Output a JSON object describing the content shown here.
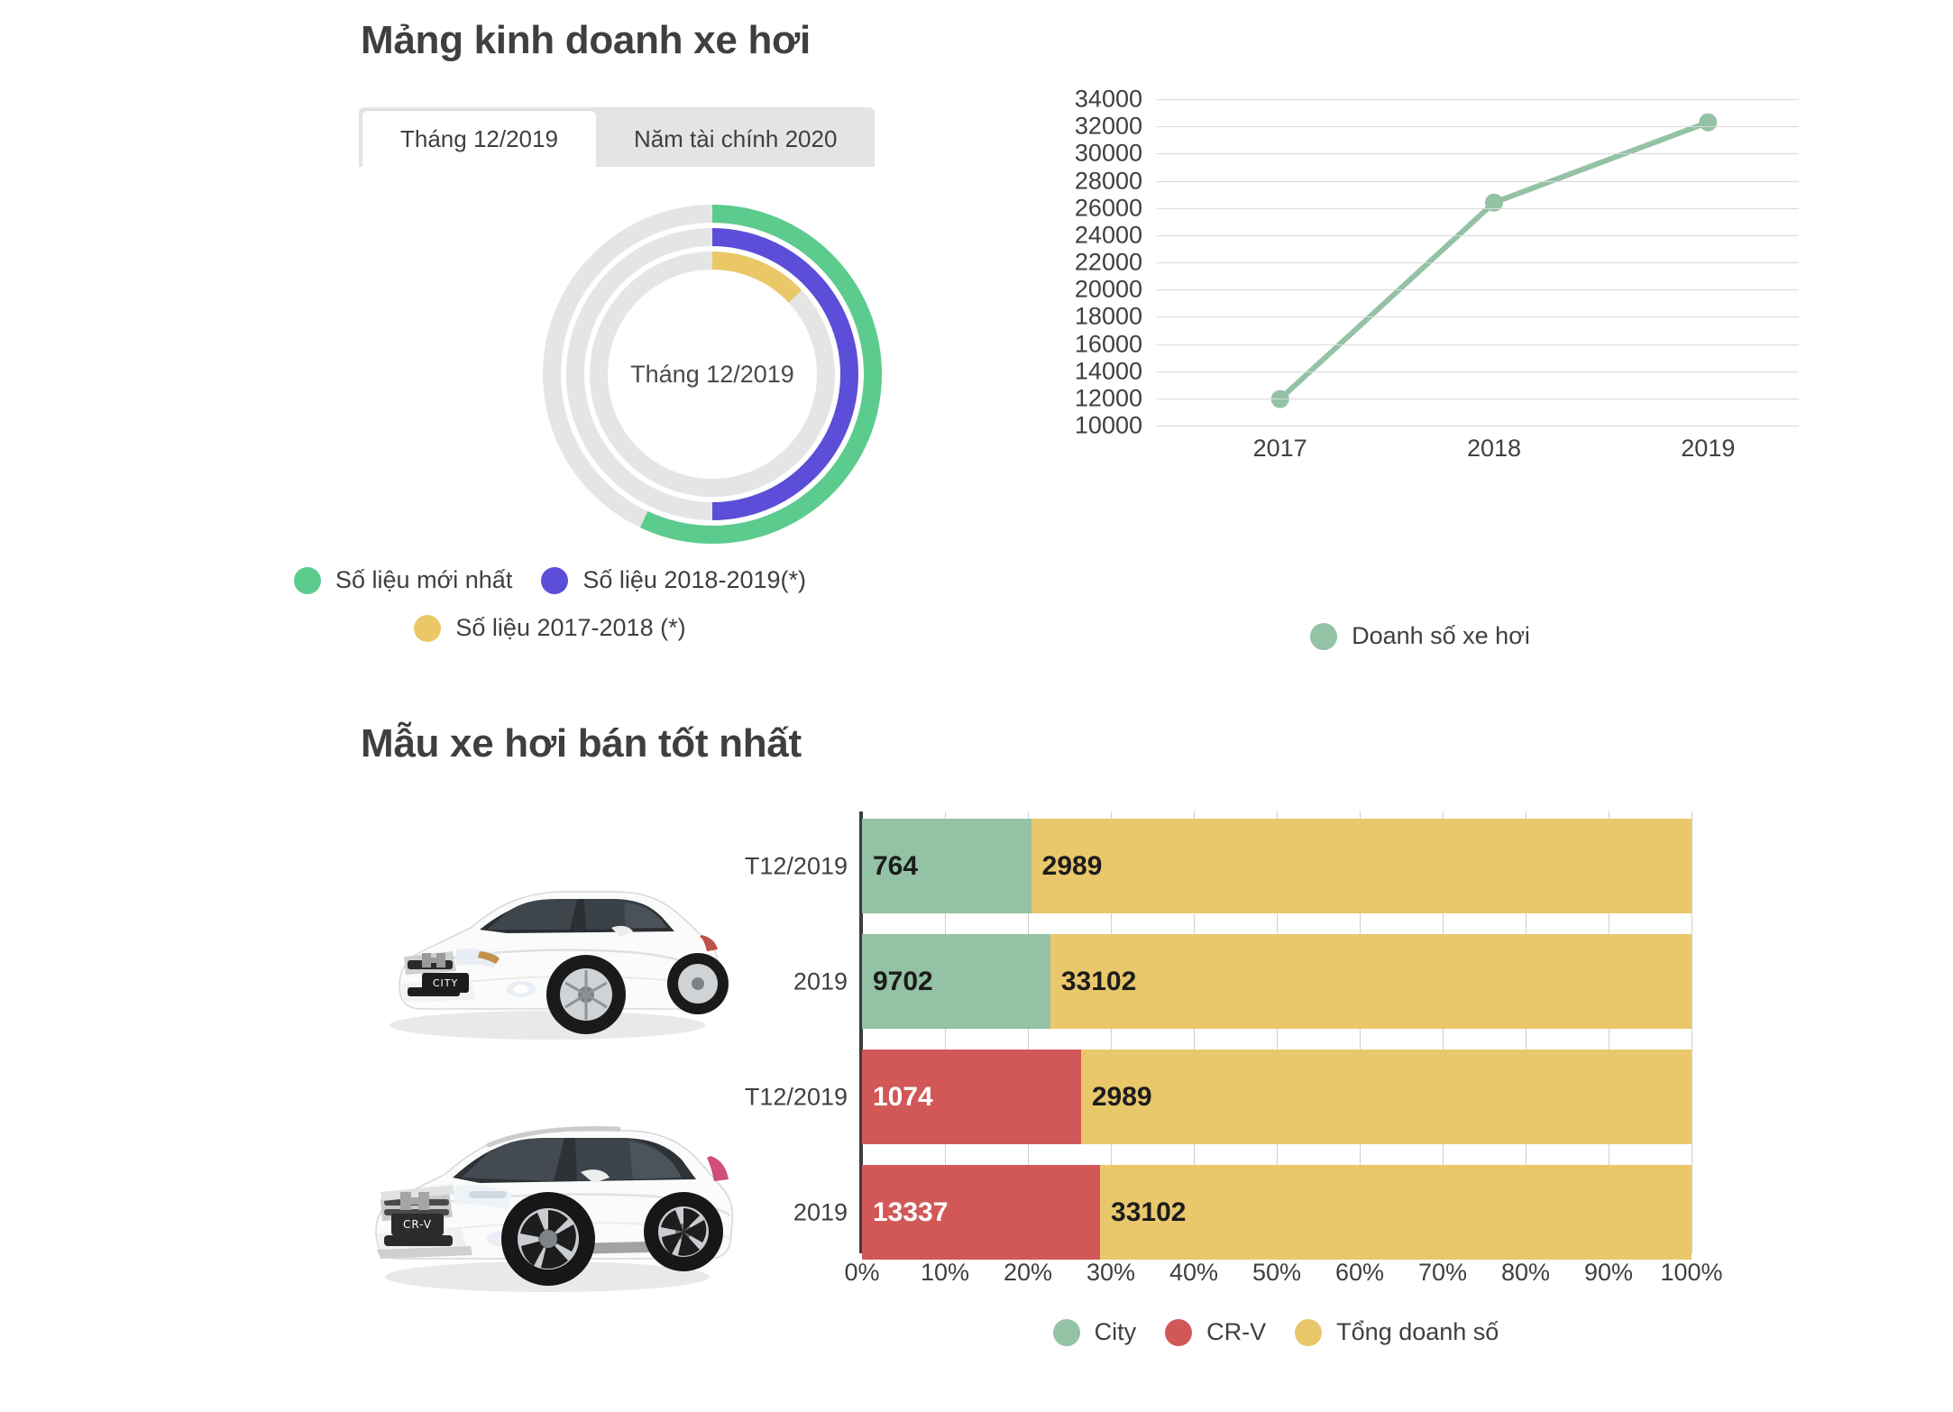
{
  "sections": {
    "top_title": "Mảng kinh doanh xe hơi",
    "bottom_title": "Mẫu xe hơi bán tốt nhất"
  },
  "tabs": [
    {
      "label": "Tháng 12/2019",
      "active": true
    },
    {
      "label": "Năm tài chính 2020",
      "active": false
    }
  ],
  "colors": {
    "green_bright": "#5ccb8e",
    "purple": "#5c4ed8",
    "yellow": "#eac867",
    "track_gray": "#e5e5e5",
    "line_green": "#93c2a4",
    "bar_green": "#93c2a4",
    "bar_red": "#d25858",
    "bar_yellow": "#e9c76b",
    "text": "#3f3f3f"
  },
  "chart_data": [
    {
      "type": "pie",
      "name": "radial-gauge-rings",
      "title": "Tháng 12/2019",
      "center_label": "Tháng 12/2019",
      "rings": [
        {
          "name": "Số liệu mới nhất",
          "percent": 57,
          "color": "#5ccb8e",
          "radius_index": 0
        },
        {
          "name": "Số liệu 2018-2019(*)",
          "percent": 50,
          "color": "#5c4ed8",
          "radius_index": 1
        },
        {
          "name": "Số liệu 2017-2018 (*)",
          "percent": 13,
          "color": "#eac867",
          "radius_index": 2
        }
      ],
      "legend": [
        {
          "label": "Số liệu mới nhất",
          "color": "#5ccb8e"
        },
        {
          "label": "Số liệu 2018-2019(*)",
          "color": "#5c4ed8"
        },
        {
          "label": "Số liệu 2017-2018 (*)",
          "color": "#eac867"
        }
      ],
      "legend_position": "bottom"
    },
    {
      "type": "line",
      "name": "doanh-so-xe-hoi-line",
      "title": "",
      "xlabel": "",
      "ylabel": "",
      "categories": [
        "2017",
        "2018",
        "2019"
      ],
      "series": [
        {
          "name": "Doanh số xe hơi",
          "values": [
            11950,
            26400,
            32300
          ],
          "color": "#93c2a4"
        }
      ],
      "ylim": [
        10000,
        34000
      ],
      "yticks": [
        34000,
        32000,
        30000,
        28000,
        26000,
        24000,
        22000,
        20000,
        18000,
        16000,
        14000,
        12000,
        10000
      ],
      "ytick_labels": [
        "34000",
        "32000",
        "30000",
        "28000",
        "26000",
        "24000",
        "22000",
        "20000",
        "18000",
        "16000",
        "14000",
        "12000",
        "10000"
      ],
      "grid": true,
      "legend": [
        {
          "label": "Doanh số xe hơi",
          "color": "#93c2a4"
        }
      ],
      "legend_position": "bottom"
    },
    {
      "type": "bar",
      "name": "best-selling-models-stacked-bar",
      "orientation": "horizontal",
      "stacked": true,
      "normalized": true,
      "title": "",
      "xlabel": "",
      "ylabel": "",
      "xlim": [
        0,
        100
      ],
      "xticks": [
        0,
        10,
        20,
        30,
        40,
        50,
        60,
        70,
        80,
        90,
        100
      ],
      "xtick_labels": [
        "0%",
        "10%",
        "20%",
        "30%",
        "40%",
        "50%",
        "60%",
        "70%",
        "80%",
        "90%",
        "100%"
      ],
      "rows": [
        {
          "label": "T12/2019",
          "model": "City",
          "segments": [
            {
              "series": "City",
              "value": 764,
              "display": "764",
              "percent": 20.4,
              "color": "#93c2a4",
              "text_color": "dark"
            },
            {
              "series": "Tổng doanh số",
              "value": 2989,
              "display": "2989",
              "percent": 79.6,
              "color": "#e9c76b",
              "text_color": "dark"
            }
          ]
        },
        {
          "label": "2019",
          "model": "City",
          "segments": [
            {
              "series": "City",
              "value": 9702,
              "display": "9702",
              "percent": 22.7,
              "color": "#93c2a4",
              "text_color": "dark"
            },
            {
              "series": "Tổng doanh số",
              "value": 33102,
              "display": "33102",
              "percent": 77.3,
              "color": "#e9c76b",
              "text_color": "dark"
            }
          ]
        },
        {
          "label": "T12/2019",
          "model": "CR-V",
          "segments": [
            {
              "series": "CR-V",
              "value": 1074,
              "display": "1074",
              "percent": 26.4,
              "color": "#d25858",
              "text_color": "light"
            },
            {
              "series": "Tổng doanh số",
              "value": 2989,
              "display": "2989",
              "percent": 73.6,
              "color": "#e9c76b",
              "text_color": "dark"
            }
          ]
        },
        {
          "label": "2019",
          "model": "CR-V",
          "segments": [
            {
              "series": "CR-V",
              "value": 13337,
              "display": "13337",
              "percent": 28.7,
              "color": "#d25858",
              "text_color": "light"
            },
            {
              "series": "Tổng doanh số",
              "value": 33102,
              "display": "33102",
              "percent": 71.3,
              "color": "#e9c76b",
              "text_color": "dark"
            }
          ]
        }
      ],
      "legend": [
        {
          "label": "City",
          "color": "#93c2a4"
        },
        {
          "label": "CR-V",
          "color": "#d25858"
        },
        {
          "label": "Tổng doanh số",
          "color": "#e9c76b"
        }
      ],
      "legend_position": "bottom"
    }
  ],
  "photos": [
    {
      "name": "honda-city-photo",
      "alt": "Honda City white sedan",
      "badge": "CITY"
    },
    {
      "name": "honda-crv-photo",
      "alt": "Honda CR-V white SUV",
      "badge": "CR-V"
    }
  ]
}
